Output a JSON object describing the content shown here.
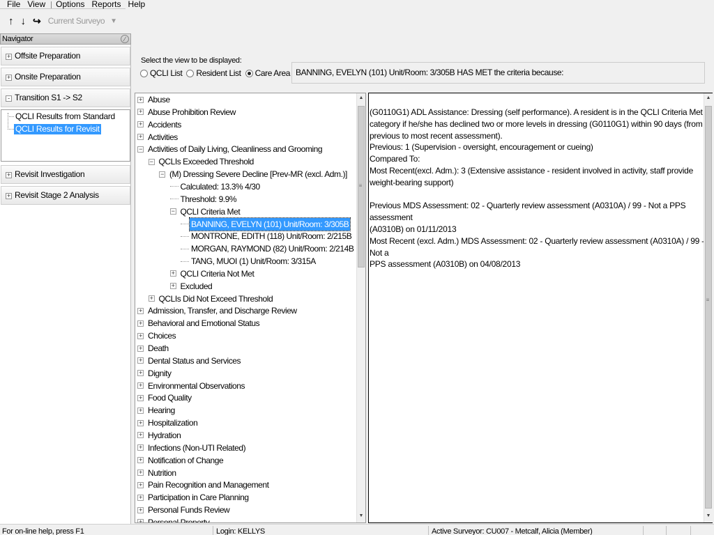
{
  "menu": {
    "file": "File",
    "view": "View",
    "options": "Options",
    "reports": "Reports",
    "help": "Help"
  },
  "toolbar": {
    "up_icon": "up-arrow-icon",
    "down_icon": "down-arrow-icon",
    "switch_icon": "switch-icon",
    "current_surveyor": "Current Surveyo"
  },
  "navigator": {
    "title": "Navigator",
    "buttons": [
      {
        "label": "Offsite Preparation",
        "sign": "+"
      },
      {
        "label": "Onsite Preparation",
        "sign": "+"
      },
      {
        "label": "Transition S1 -> S2",
        "sign": "-"
      },
      {
        "label": "Revisit Investigation",
        "sign": "+"
      },
      {
        "label": "Revisit Stage 2 Analysis",
        "sign": "+"
      }
    ],
    "items": [
      {
        "label": "QCLI Results from Standard",
        "selected": false
      },
      {
        "label": "QCLI Results for Revisit",
        "selected": true
      }
    ]
  },
  "view_selector": {
    "prompt": "Select the view to be displayed:",
    "options": [
      {
        "label": "QCLI List",
        "selected": false
      },
      {
        "label": "Resident List",
        "selected": false
      },
      {
        "label": "Care Area List",
        "selected": true
      }
    ]
  },
  "criteria_header": "BANNING, EVELYN (101) Unit/Room: 3/305B HAS MET the criteria because:",
  "tree": {
    "top_items_a": [
      "Abuse",
      "Abuse Prohibition Review",
      "Accidents",
      "Activities"
    ],
    "adl": "Activities of Daily Living, Cleanliness and Grooming",
    "exceeded": "QCLIs Exceeded Threshold",
    "dressing": "(M) Dressing Severe Decline [Prev-MR (excl. Adm.)]",
    "calculated": "Calculated: 13.3% 4/30",
    "threshold": "Threshold: 9.9%",
    "criteria_met": "QCLI Criteria Met",
    "residents": [
      {
        "label": "BANNING, EVELYN (101) Unit/Room: 3/305B",
        "selected": true
      },
      {
        "label": "MONTRONE, EDITH (118) Unit/Room: 2/215B",
        "selected": false
      },
      {
        "label": "MORGAN, RAYMOND (82) Unit/Room: 2/214B",
        "selected": false
      },
      {
        "label": "TANG, MUOI (1) Unit/Room: 3/315A",
        "selected": false
      }
    ],
    "criteria_not_met": "QCLI Criteria Not Met",
    "excluded": "Excluded",
    "not_exceed": "QCLIs Did Not Exceed Threshold",
    "top_items_b": [
      "Admission, Transfer, and Discharge Review",
      "Behavioral and Emotional Status",
      "Choices",
      "Death",
      "Dental Status and Services",
      "Dignity",
      "Environmental Observations",
      "Food Quality",
      "Hearing",
      "Hospitalization",
      "Hydration",
      "Infections (Non-UTI Related)",
      "Notification of Change",
      "Nutrition",
      "Pain Recognition and Management",
      "Participation in Care Planning",
      "Personal Funds Review",
      "Personal Property"
    ]
  },
  "detail": {
    "lines": [
      "(G0110G1) ADL Assistance: Dressing (self performance). A resident is in the QCLI Criteria Met",
      "category if he/she has declined two or more levels in dressing (G0110G1) within 90 days (from",
      "previous to most recent assessment).",
      "Previous: 1 (Supervision - oversight, encouragement or cueing)",
      "Compared To:",
      "Most Recent(excl. Adm.): 3 (Extensive assistance - resident involved in activity, staff provide",
      "weight-bearing support)",
      "",
      "Previous MDS Assessment: 02 - Quarterly review assessment (A0310A) / 99 - Not a PPS assessment",
      "(A0310B) on 01/11/2013",
      "Most Recent (excl. Adm.) MDS Assessment: 02 - Quarterly review assessment (A0310A) / 99 - Not a",
      "PPS assessment (A0310B) on 04/08/2013"
    ]
  },
  "status": {
    "help": "For on-line help, press F1",
    "login": "Login: KELLYS",
    "surveyor": "Active Surveyor: CU007 - Metcalf, Alicia  (Member)"
  }
}
